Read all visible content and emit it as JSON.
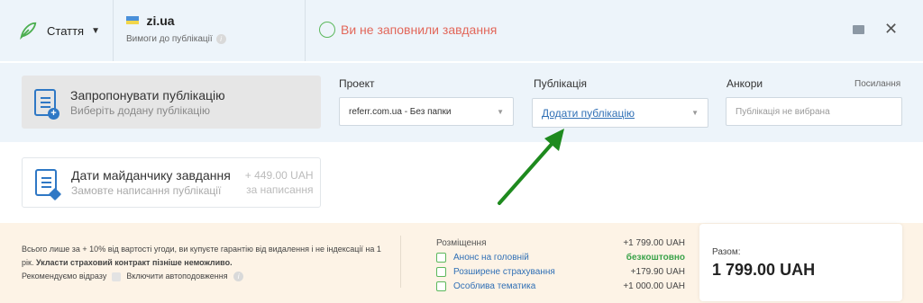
{
  "header": {
    "type_label": "Стаття",
    "site_name": "zi.ua",
    "requirements_label": "Вимоги до публікації",
    "status_text": "Ви не заповнили завдання"
  },
  "offer": {
    "title": "Запропонувати публікацію",
    "subtitle": "Виберіть додану публікацію"
  },
  "project": {
    "label": "Проект",
    "value": "referr.com.ua  -  Без папки"
  },
  "publication": {
    "label": "Публікація",
    "value": "Додати публікацію"
  },
  "anchors": {
    "label": "Анкори",
    "links_label": "Посилання",
    "placeholder": "Публікація не вибрана"
  },
  "give_task": {
    "title": "Дати майданчику завдання",
    "subtitle": "Замовте написання публікації",
    "price": "+ 449.00 UAH",
    "price_sub": "за написання"
  },
  "insurance": {
    "text1": "Всього лише за + 10% від вартості угоди, ви купуєте гарантію від видалення і не індексації на 1 рік.",
    "text_bold": "Укласти страховий контракт пізніше неможливо.",
    "recommend": "Рекомендуємо відразу",
    "auto_renew": "Включити автоподовження"
  },
  "options": {
    "placement_label": "Розміщення",
    "placement_value": "+1 799.00 UAH",
    "items": [
      {
        "label": "Анонс на головній",
        "value": "безкоштовно"
      },
      {
        "label": "Розширене страхування",
        "value": "+179.90 UAH"
      },
      {
        "label": "Особлива тематика",
        "value": "+1 000.00 UAH"
      }
    ]
  },
  "total": {
    "label": "Разом:",
    "amount": "1 799.00 UAH"
  },
  "colors": {
    "accent": "#2f78c5",
    "warning_text": "#e2675a",
    "success": "#5cb85c",
    "arrow": "#1e8a1e"
  }
}
